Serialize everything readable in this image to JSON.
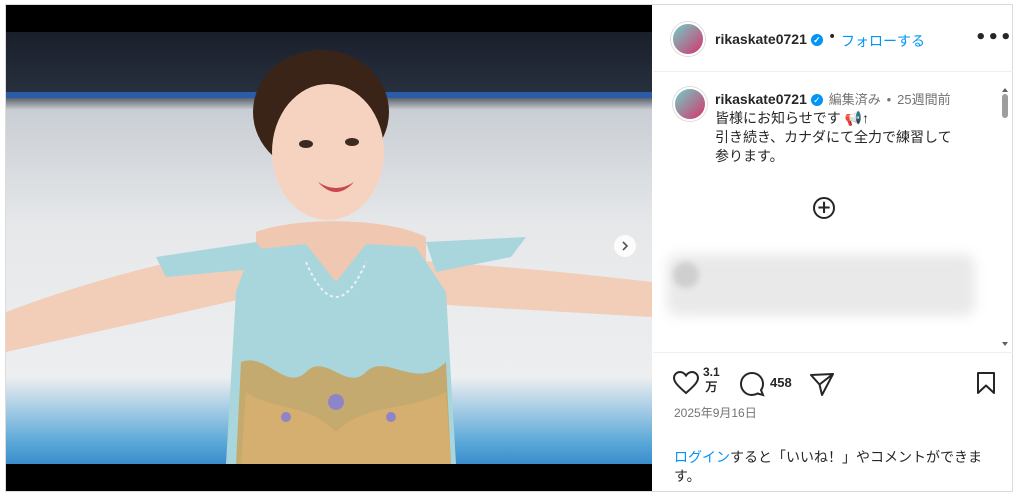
{
  "post": {
    "username": "rikaskate0721",
    "follow_label": "フォローする",
    "more_label": "•••",
    "dot": "•"
  },
  "caption": {
    "username": "rikaskate0721",
    "edited": "編集済み",
    "dot": "•",
    "age": "25週間前",
    "lines": [
      "皆様にお知らせです 📢↑",
      "引き続き、カナダにて全力で練習して",
      "参ります。"
    ],
    "load_more_icon": "plus-circle-icon"
  },
  "stats": {
    "likes": "3.1",
    "likes_unit": "万",
    "comments": "458",
    "date": "2025年9月16日"
  },
  "login_prompt": {
    "link": "ログイン",
    "text": "すると「いいね！」やコメントができます。"
  },
  "icons": {
    "next": "chevron-right-icon",
    "like": "heart-icon",
    "comment": "comment-icon",
    "share": "send-icon",
    "save": "bookmark-icon",
    "verified": "verified-badge-icon"
  },
  "colors": {
    "link": "#0095f6",
    "text": "#262626",
    "muted": "#737373",
    "border": "#dbdbdb"
  }
}
